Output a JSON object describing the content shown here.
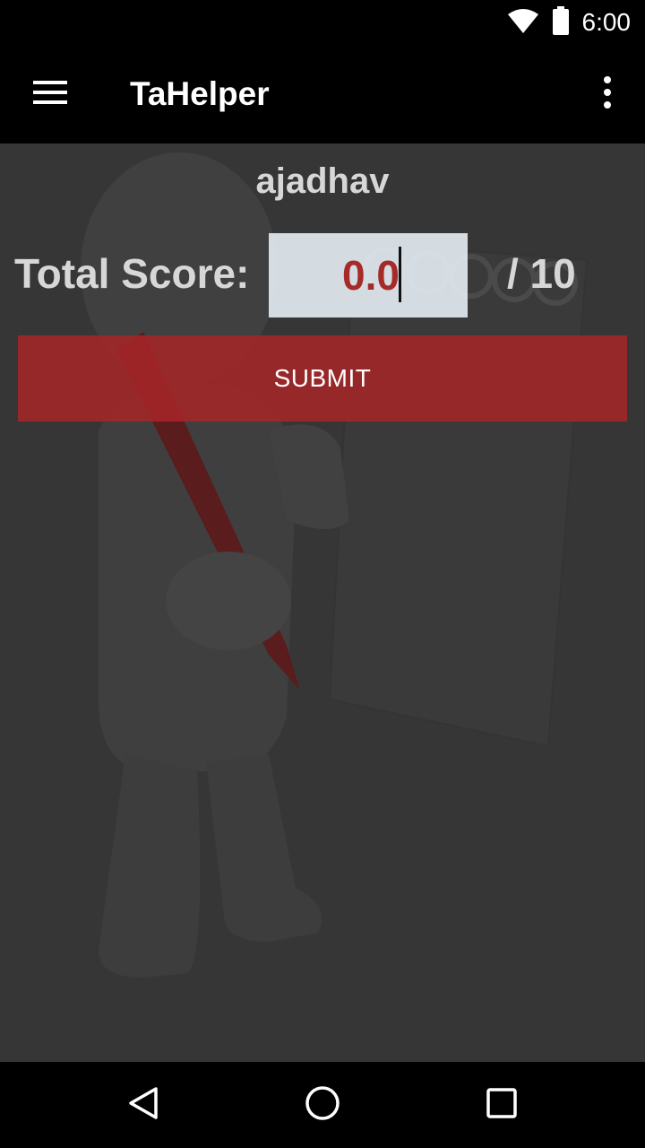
{
  "status_bar": {
    "time": "6:00",
    "icons": [
      "wifi-icon",
      "battery-icon"
    ]
  },
  "app_bar": {
    "title": "TaHelper",
    "menu_icon": "hamburger-menu-icon",
    "overflow_icon": "more-vert-icon"
  },
  "grading": {
    "username": "ajadhav",
    "score_label": "Total Score:",
    "score_value": "0.0",
    "max_score": "/ 10",
    "submit_label": "SUBMIT"
  },
  "nav_bar": {
    "icons": [
      "back-icon",
      "home-icon",
      "recents-icon"
    ]
  },
  "colors": {
    "accent": "#a82628",
    "score_text": "#a62a2a",
    "background": "#363636"
  }
}
